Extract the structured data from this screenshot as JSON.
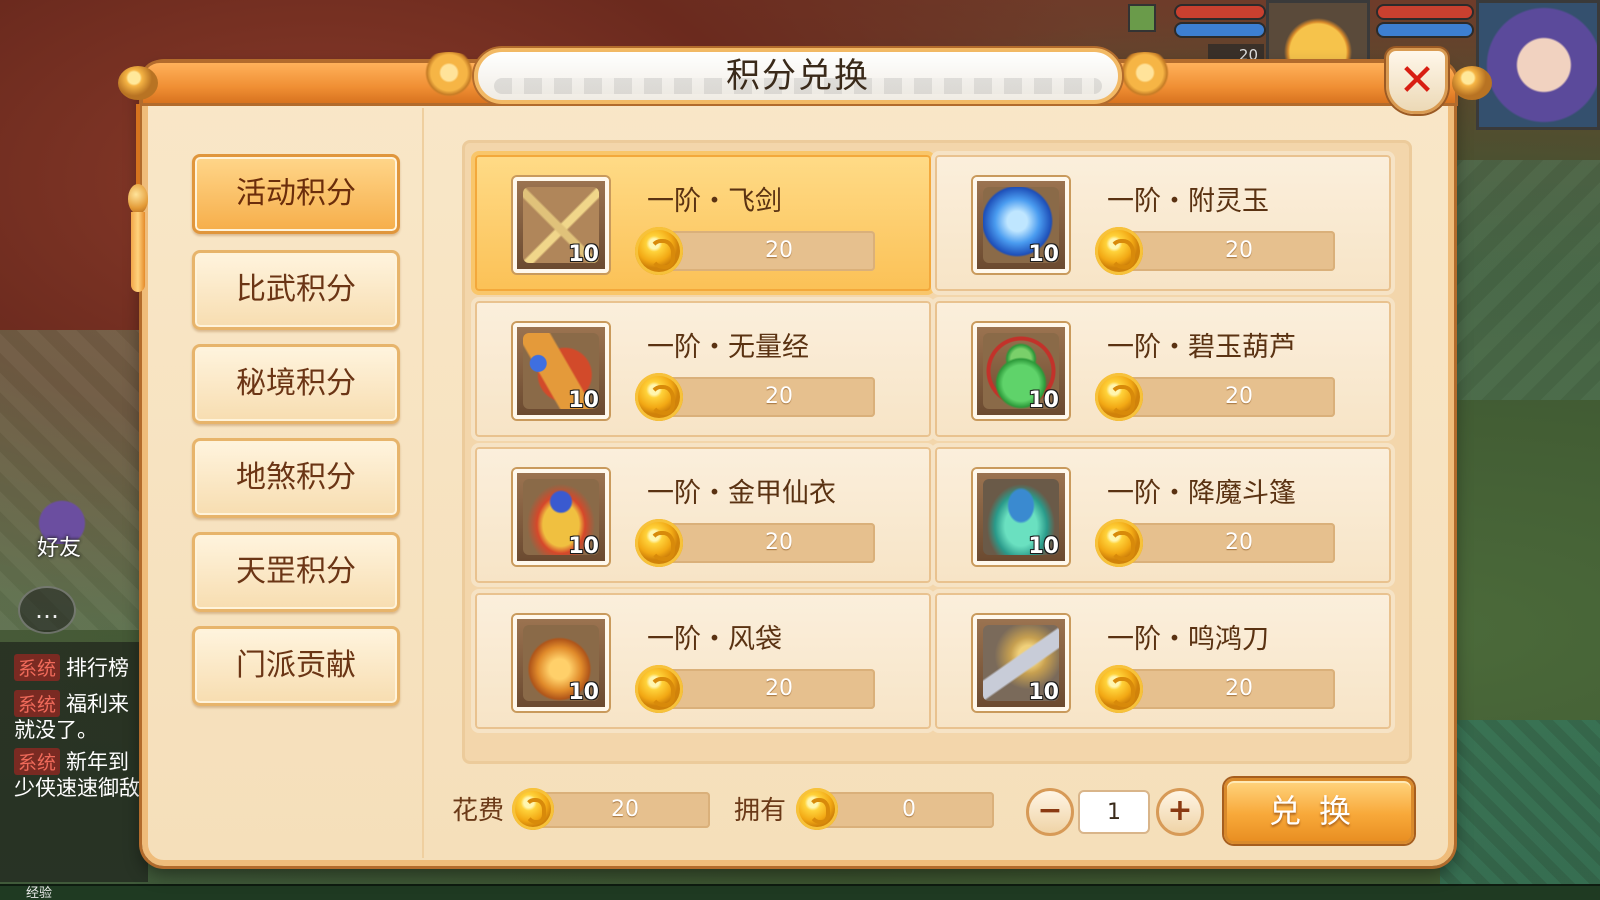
{
  "hud": {
    "level_text": "20",
    "friend_label": "好友",
    "chat_icon": "chat-bubble-icon",
    "xp_label": "经验"
  },
  "chat": [
    {
      "tag": "系统",
      "text": "排行榜"
    },
    {
      "tag": "系统",
      "text": "福利来"
    },
    {
      "tag": "",
      "text": "就没了。"
    },
    {
      "tag": "系统",
      "text": "新年到"
    },
    {
      "tag": "",
      "text": "少侠速速御敌"
    }
  ],
  "dialog": {
    "title": "积分兑换",
    "close_icon": "close-icon"
  },
  "categories": [
    {
      "label": "活动积分",
      "active": true
    },
    {
      "label": "比武积分",
      "active": false
    },
    {
      "label": "秘境积分",
      "active": false
    },
    {
      "label": "地煞积分",
      "active": false
    },
    {
      "label": "天罡积分",
      "active": false
    },
    {
      "label": "门派贡献",
      "active": false
    }
  ],
  "items": [
    {
      "name": "一阶・飞剑",
      "qty": "10",
      "price": "20",
      "icon": "crossed-swords-icon",
      "selected": true,
      "color": "#c9a25a"
    },
    {
      "name": "一阶・附灵玉",
      "qty": "10",
      "price": "20",
      "icon": "blue-jade-icon",
      "selected": false,
      "color": "#3c7fe0"
    },
    {
      "name": "一阶・无量经",
      "qty": "10",
      "price": "20",
      "icon": "scripture-scroll-icon",
      "selected": false,
      "color": "#c0482a"
    },
    {
      "name": "一阶・碧玉葫芦",
      "qty": "10",
      "price": "20",
      "icon": "jade-gourd-icon",
      "selected": false,
      "color": "#3aa84a"
    },
    {
      "name": "一阶・金甲仙衣",
      "qty": "10",
      "price": "20",
      "icon": "golden-armor-icon",
      "selected": false,
      "color": "#d6482a"
    },
    {
      "name": "一阶・降魔斗篷",
      "qty": "10",
      "price": "20",
      "icon": "demon-cloak-icon",
      "selected": false,
      "color": "#3aa8a0"
    },
    {
      "name": "一阶・风袋",
      "qty": "10",
      "price": "20",
      "icon": "wind-bag-icon",
      "selected": false,
      "color": "#e08a2a"
    },
    {
      "name": "一阶・鸣鸿刀",
      "qty": "10",
      "price": "20",
      "icon": "minghong-blade-icon",
      "selected": false,
      "color": "#8a8a9a"
    }
  ],
  "footer": {
    "cost_label": "花费",
    "cost_value": "20",
    "own_label": "拥有",
    "own_value": "0",
    "quantity": "1",
    "minus_icon": "minus-icon",
    "plus_icon": "plus-icon",
    "exchange_label": "兑换"
  },
  "colors": {
    "panel": "#f9e7c8",
    "frame_orange": "#f08f34",
    "active_tab": "#f6ae4a",
    "price_bar": "#e6c08e",
    "close_x": "#d81e12"
  }
}
